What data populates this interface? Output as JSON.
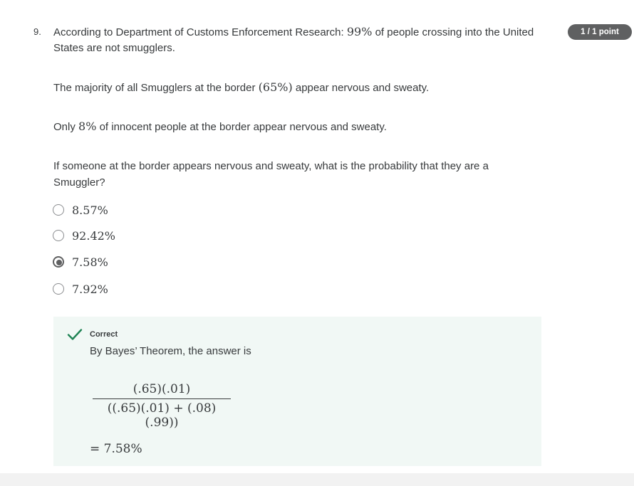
{
  "question": {
    "number": "9.",
    "points": "1 / 1 point",
    "paragraphs": [
      {
        "pre": "According to Department of Customs Enforcement Research: ",
        "math": "99%",
        "post": " of people crossing into the United States are not smugglers."
      },
      {
        "pre": "The majority of all Smugglers at the border ",
        "math": "(65%)",
        "post": " appear nervous and sweaty."
      },
      {
        "pre": "Only ",
        "math": "8%",
        "post": " of innocent people at the border appear nervous and sweaty."
      },
      {
        "pre": "If someone at the border appears nervous and sweaty, what is the probability that they are a Smuggler?",
        "math": "",
        "post": ""
      }
    ],
    "options": [
      {
        "label": "8.57%",
        "selected": false
      },
      {
        "label": "92.42%",
        "selected": false
      },
      {
        "label": "7.58%",
        "selected": true
      },
      {
        "label": "7.92%",
        "selected": false
      }
    ]
  },
  "feedback": {
    "icon": "checkmark-icon",
    "status": "Correct",
    "text": "By Bayes’ Theorem, the answer is",
    "numerator": "(.65)(.01)",
    "denominator": "((.65)(.01) + (.08)(.99))",
    "result": "= 7.58%"
  },
  "colors": {
    "badge_bg": "#5f6061",
    "feedback_bg": "#f1f8f5",
    "check_green": "#1f8354",
    "text": "#373a3c"
  }
}
